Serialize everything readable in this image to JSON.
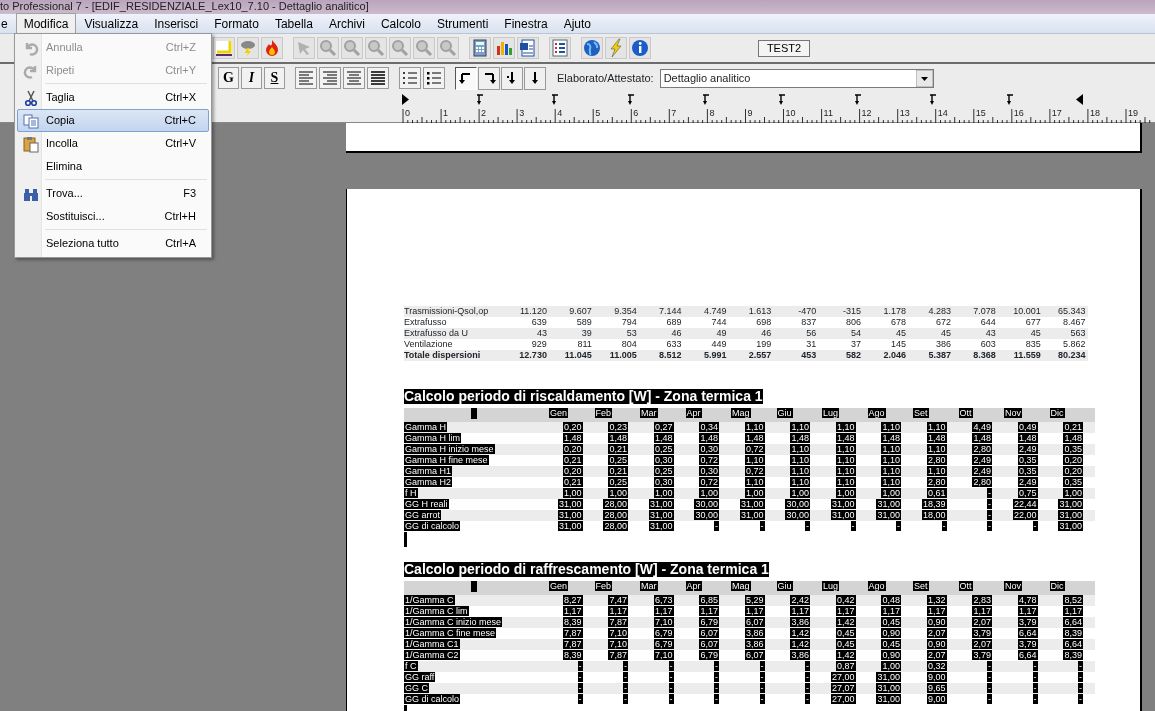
{
  "window": {
    "title": "to Professional 7 - [EDIF_RESIDENZIALE_Lex10_7.10 - Dettaglio analitico]"
  },
  "menu_bar": [
    {
      "label": "e",
      "selected": false
    },
    {
      "label": "Modifica",
      "selected": true
    },
    {
      "label": "Visualizza",
      "selected": false
    },
    {
      "label": "Inserisci",
      "selected": false
    },
    {
      "label": "Formato",
      "selected": false
    },
    {
      "label": "Tabella",
      "selected": false
    },
    {
      "label": "Archivi",
      "selected": false
    },
    {
      "label": "Calcolo",
      "selected": false
    },
    {
      "label": "Strumenti",
      "selected": false
    },
    {
      "label": "Finestra",
      "selected": false
    },
    {
      "label": "Ajuto",
      "selected": false
    }
  ],
  "edit_menu": [
    {
      "kind": "item",
      "label": "Annulla",
      "shortcut": "Ctrl+Z",
      "disabled": true,
      "selected": false
    },
    {
      "kind": "item",
      "label": "Ripeti",
      "shortcut": "Ctrl+Y",
      "disabled": true,
      "selected": false
    },
    {
      "kind": "separator"
    },
    {
      "kind": "item",
      "label": "Taglia",
      "shortcut": "Ctrl+X",
      "disabled": false,
      "selected": false
    },
    {
      "kind": "item",
      "label": "Copia",
      "shortcut": "Ctrl+C",
      "disabled": false,
      "selected": true
    },
    {
      "kind": "item",
      "label": "Incolla",
      "shortcut": "Ctrl+V",
      "disabled": false,
      "selected": false
    },
    {
      "kind": "item",
      "label": "Elimina",
      "disabled": false,
      "selected": false
    },
    {
      "kind": "separator"
    },
    {
      "kind": "item",
      "label": "Trova...",
      "shortcut": "F3",
      "disabled": false,
      "selected": false
    },
    {
      "kind": "item",
      "label": "Sostituisci...",
      "shortcut": "Ctrl+H",
      "disabled": false,
      "selected": false
    },
    {
      "kind": "separator"
    },
    {
      "kind": "item",
      "label": "Seleziona tutto",
      "shortcut": "Ctrl+A",
      "disabled": false,
      "selected": false
    }
  ],
  "toolbar": {
    "test_button": "TEST2"
  },
  "format_bar": {
    "style_buttons": [
      {
        "label": "G",
        "kind": "bold"
      },
      {
        "label": "I",
        "kind": "italic"
      },
      {
        "label": "S",
        "kind": "underline"
      }
    ],
    "tab_buttons": [
      {
        "kind": "left",
        "selected": true
      },
      {
        "kind": "right",
        "selected": false
      },
      {
        "kind": "decimal",
        "selected": false
      },
      {
        "kind": "center",
        "selected": false
      }
    ],
    "report_label": "Elaborato/Attestato:",
    "report_value": "Dettaglio analitico"
  },
  "ruler": {
    "labels": [
      "0",
      "1",
      "2",
      "3",
      "4",
      "5",
      "6",
      "7",
      "8",
      "9",
      "10",
      "11",
      "12",
      "13",
      "14",
      "15",
      "16",
      "17",
      "18",
      "19"
    ]
  },
  "dispersion_table": {
    "highlighted": false,
    "rows": [
      {
        "label": "Trasmissioni-Qsol,op",
        "total": false,
        "values": [
          "11.120",
          "9.607",
          "9.354",
          "7.144",
          "4.749",
          "1.613",
          "-470",
          "-315",
          "1.178",
          "4.283",
          "7.078",
          "10.001",
          "65.343"
        ]
      },
      {
        "label": "Extrafusso",
        "total": false,
        "values": [
          "639",
          "589",
          "794",
          "689",
          "744",
          "698",
          "837",
          "806",
          "678",
          "672",
          "644",
          "677",
          "8.467"
        ]
      },
      {
        "label": "Extrafusso da U",
        "total": false,
        "values": [
          "43",
          "39",
          "53",
          "46",
          "49",
          "46",
          "56",
          "54",
          "45",
          "45",
          "43",
          "45",
          "563"
        ]
      },
      {
        "label": "Ventilazione",
        "total": false,
        "values": [
          "929",
          "811",
          "804",
          "633",
          "449",
          "199",
          "31",
          "37",
          "145",
          "386",
          "603",
          "835",
          "5.862"
        ]
      },
      {
        "label": "Totale dispersioni",
        "total": true,
        "values": [
          "12.730",
          "11.045",
          "11.005",
          "8.512",
          "5.991",
          "2.557",
          "453",
          "582",
          "2.046",
          "5.387",
          "8.368",
          "11.559",
          "80.234"
        ]
      }
    ]
  },
  "heating_table": {
    "title": "Calcolo periodo di riscaldamento [W] - Zona termica 1",
    "highlighted": true,
    "columns": [
      "Gen",
      "Feb",
      "Mar",
      "Apr",
      "Mag",
      "Giu",
      "Lug",
      "Ago",
      "Set",
      "Ott",
      "Nov",
      "Dic"
    ],
    "rows": [
      {
        "label": "Gamma H",
        "values": [
          "0,20",
          "0,23",
          "0,27",
          "0,34",
          "1,10",
          "1,10",
          "1,10",
          "1,10",
          "1,10",
          "4,49",
          "0,49",
          "0,21"
        ]
      },
      {
        "label": "Gamma H lim",
        "values": [
          "1,48",
          "1,48",
          "1,48",
          "1,48",
          "1,48",
          "1,48",
          "1,48",
          "1,48",
          "1,48",
          "1,48",
          "1,48",
          "1,48"
        ]
      },
      {
        "label": "Gamma H inizio mese",
        "values": [
          "0,20",
          "0,21",
          "0,25",
          "0,30",
          "0,72",
          "1,10",
          "1,10",
          "1,10",
          "1,10",
          "2,80",
          "2,49",
          "0,35"
        ]
      },
      {
        "label": "Gamma H fine mese",
        "values": [
          "0,21",
          "0,25",
          "0,30",
          "0,72",
          "1,10",
          "1,10",
          "1,10",
          "1,10",
          "2,80",
          "2,49",
          "0,35",
          "0,20"
        ]
      },
      {
        "label": "Gamma H1",
        "values": [
          "0,20",
          "0,21",
          "0,25",
          "0,30",
          "0,72",
          "1,10",
          "1,10",
          "1,10",
          "1,10",
          "2,49",
          "0,35",
          "0,20"
        ]
      },
      {
        "label": "Gamma H2",
        "values": [
          "0,21",
          "0,25",
          "0,30",
          "0,72",
          "1,10",
          "1,10",
          "1,10",
          "1,10",
          "2,80",
          "2,80",
          "2,49",
          "0,35"
        ]
      },
      {
        "label": "f H",
        "values": [
          "1,00",
          "1,00",
          "1,00",
          "1,00",
          "1,00",
          "1,00",
          "1,00",
          "1,00",
          "0,61",
          "-",
          "0,75",
          "1,00"
        ]
      },
      {
        "label": "GG H reali",
        "values": [
          "31,00",
          "28,00",
          "31,00",
          "30,00",
          "31,00",
          "30,00",
          "31,00",
          "31,00",
          "18,39",
          "-",
          "22,44",
          "31,00"
        ]
      },
      {
        "label": "GG arrot",
        "values": [
          "31,00",
          "28,00",
          "31,00",
          "30,00",
          "31,00",
          "30,00",
          "31,00",
          "31,00",
          "18,00",
          "-",
          "22,00",
          "31,00"
        ]
      },
      {
        "label": "GG di calcolo",
        "values": [
          "31,00",
          "28,00",
          "31,00",
          "-",
          "-",
          "-",
          "-",
          "-",
          "-",
          "-",
          "-",
          "31,00"
        ]
      }
    ]
  },
  "cooling_table": {
    "title": "Calcolo periodo di raffrescamento [W] - Zona termica 1",
    "highlighted": true,
    "columns": [
      "Gen",
      "Feb",
      "Mar",
      "Apr",
      "Mag",
      "Giu",
      "Lug",
      "Ago",
      "Set",
      "Ott",
      "Nov",
      "Dic"
    ],
    "rows": [
      {
        "label": "1/Gamma C",
        "values": [
          "8,27",
          "7,47",
          "6,73",
          "6,85",
          "5,29",
          "2,42",
          "0,42",
          "0,48",
          "1,32",
          "2,83",
          "4,78",
          "8,52"
        ]
      },
      {
        "label": "1/Gamma C lim",
        "values": [
          "1,17",
          "1,17",
          "1,17",
          "1,17",
          "1,17",
          "1,17",
          "1,17",
          "1,17",
          "1,17",
          "1,17",
          "1,17",
          "1,17"
        ]
      },
      {
        "label": "1/Gamma C inizio mese",
        "values": [
          "8,39",
          "7,87",
          "7,10",
          "6,79",
          "6,07",
          "3,86",
          "1,42",
          "0,45",
          "0,90",
          "2,07",
          "3,79",
          "6,64"
        ]
      },
      {
        "label": "1/Gamma C fine mese",
        "values": [
          "7,87",
          "7,10",
          "6,79",
          "6,07",
          "3,86",
          "1,42",
          "0,45",
          "0,90",
          "2,07",
          "3,79",
          "6,64",
          "8,39"
        ]
      },
      {
        "label": "1/Gamma C1",
        "values": [
          "7,87",
          "7,10",
          "6,79",
          "6,07",
          "3,86",
          "1,42",
          "0,45",
          "0,45",
          "0,90",
          "2,07",
          "3,79",
          "6,64"
        ]
      },
      {
        "label": "1/Gamma C2",
        "values": [
          "8,39",
          "7,87",
          "7,10",
          "6,79",
          "6,07",
          "3,86",
          "1,42",
          "0,90",
          "2,07",
          "3,79",
          "6,64",
          "8,39"
        ]
      },
      {
        "label": "f C",
        "values": [
          "-",
          "-",
          "-",
          "-",
          "-",
          "-",
          "0,87",
          "1,00",
          "0,32",
          "-",
          "-",
          "-"
        ]
      },
      {
        "label": "GG raff",
        "values": [
          "-",
          "-",
          "-",
          "-",
          "-",
          "-",
          "27,00",
          "31,00",
          "9,00",
          "-",
          "-",
          "-"
        ]
      },
      {
        "label": "GG C",
        "values": [
          "-",
          "-",
          "-",
          "-",
          "-",
          "-",
          "27,07",
          "31,00",
          "9,65",
          "-",
          "-",
          "-"
        ]
      },
      {
        "label": "GG di calcolo",
        "values": [
          "-",
          "-",
          "-",
          "-",
          "-",
          "-",
          "27,00",
          "31,00",
          "9,00",
          "-",
          "-",
          "-"
        ]
      }
    ]
  }
}
